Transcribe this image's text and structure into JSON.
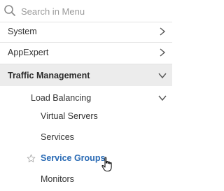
{
  "search": {
    "placeholder": "Search in Menu"
  },
  "menu": {
    "system": "System",
    "appexpert": "AppExpert",
    "traffic_management": "Traffic Management",
    "load_balancing": "Load Balancing",
    "virtual_servers": "Virtual Servers",
    "services": "Services",
    "service_groups": "Service Groups",
    "monitors": "Monitors"
  },
  "icons": {
    "search": "search-icon",
    "chevron_right": "chevron-right-icon",
    "chevron_down": "chevron-down-icon",
    "star": "star-icon",
    "cursor": "pointer-hand-icon"
  },
  "colors": {
    "selected_text": "#2a6bb5",
    "active_row_bg": "#ececec"
  }
}
